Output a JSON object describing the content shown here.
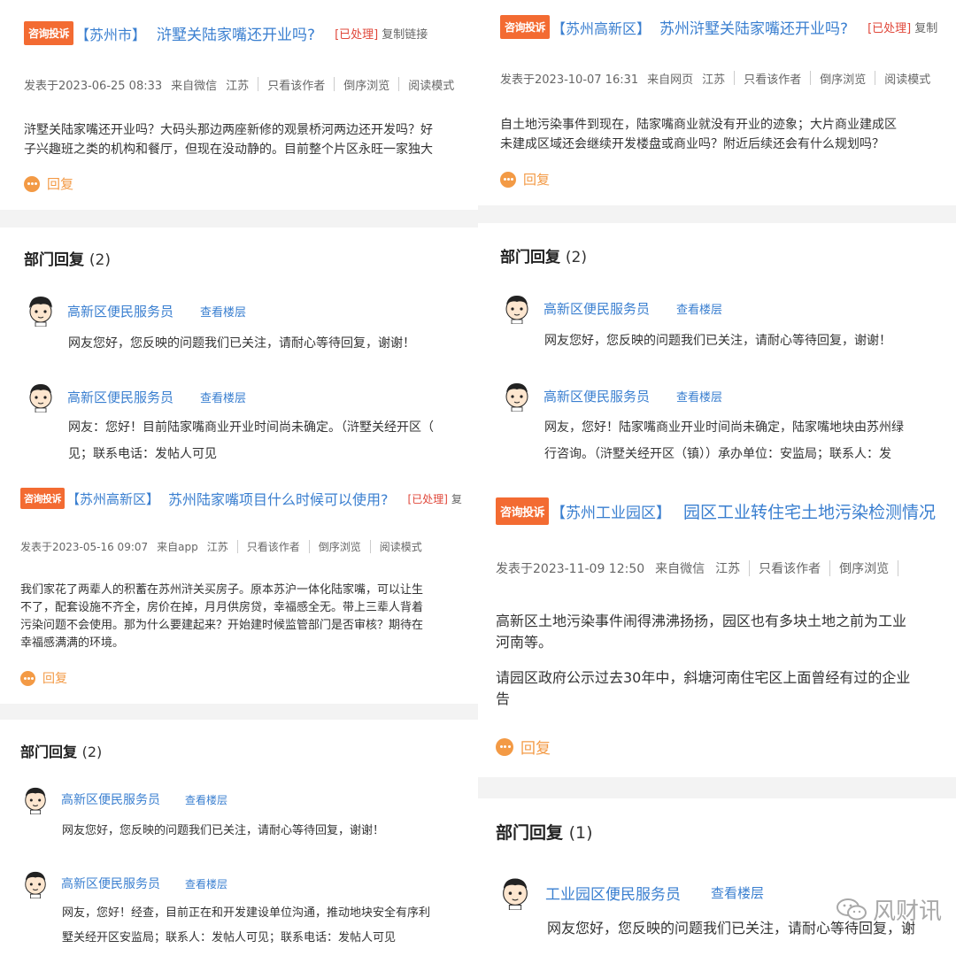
{
  "panels": [
    {
      "badge": "咨询投诉",
      "region": "【苏州市】",
      "title": "浒墅关陆家嘴还开业吗?",
      "status": "[已处理]",
      "copy": "复制链接",
      "meta": [
        "发表于2023-06-25 08:33",
        "来自微信",
        "江苏",
        "只看该作者",
        "倒序浏览",
        "阅读模式"
      ],
      "content": [
        "浒墅关陆家嘴还开业吗？大码头那边两座新修的观景桥河两边还开发吗？好",
        "子兴趣班之类的机构和餐厅，但现在没动静的。目前整个片区永旺一家独大"
      ],
      "reply": "回复",
      "dept_title": "部门回复",
      "dept_count": "(2)",
      "replies": [
        {
          "name": "高新区便民服务员",
          "check": "查看楼层",
          "lines": [
            "网友您好，您反映的问题我们已关注，请耐心等待回复，谢谢！"
          ]
        },
        {
          "name": "高新区便民服务员",
          "check": "查看楼层",
          "lines": [
            "网友：您好！目前陆家嘴商业开业时间尚未确定。（浒墅关经开区（",
            "见；联系电话：发帖人可见"
          ]
        }
      ]
    },
    {
      "badge": "咨询投诉",
      "region": "【苏州高新区】",
      "title": "苏州浒墅关陆家嘴还开业吗?",
      "status": "[已处理]",
      "copy": "复制",
      "meta": [
        "发表于2023-10-07 16:31",
        "来自网页",
        "江苏",
        "只看该作者",
        "倒序浏览",
        "阅读模式"
      ],
      "content": [
        "自土地污染事件到现在，陆家嘴商业就没有开业的迹象；大片商业建成区",
        "未建成区域还会继续开发楼盘或商业吗？附近后续还会有什么规划吗？"
      ],
      "reply": "回复",
      "dept_title": "部门回复",
      "dept_count": "(2)",
      "replies": [
        {
          "name": "高新区便民服务员",
          "check": "查看楼层",
          "lines": [
            "网友您好，您反映的问题我们已关注，请耐心等待回复，谢谢！"
          ]
        },
        {
          "name": "高新区便民服务员",
          "check": "查看楼层",
          "lines": [
            "网友，您好！陆家嘴商业开业时间尚未确定，陆家嘴地块由苏州绿",
            "行咨询。（浒墅关经开区（镇））承办单位：安监局；联系人：发"
          ]
        }
      ]
    },
    {
      "badge": "咨询投诉",
      "region": "【苏州高新区】",
      "title": "苏州陆家嘴项目什么时候可以使用?",
      "status": "[已处理]",
      "copy": "复",
      "meta": [
        "发表于2023-05-16 09:07",
        "来自app",
        "江苏",
        "只看该作者",
        "倒序浏览",
        "阅读模式"
      ],
      "content": [
        "我们家花了两辈人的积蓄在苏州浒关买房子。原本苏沪一体化陆家嘴，可以让生",
        "不了，配套设施不齐全，房价在掉，月月供房贷，幸福感全无。带上三辈人背着",
        "污染问题不会使用。那为什么要建起来？开始建时候监管部门是否审核？期待在",
        "幸福感满满的环境。"
      ],
      "reply": "回复",
      "dept_title": "部门回复",
      "dept_count": "(2)",
      "replies": [
        {
          "name": "高新区便民服务员",
          "check": "查看楼层",
          "lines": [
            "网友您好，您反映的问题我们已关注，请耐心等待回复，谢谢！"
          ]
        },
        {
          "name": "高新区便民服务员",
          "check": "查看楼层",
          "lines": [
            "网友，您好！经查，目前正在和开发建设单位沟通，推动地块安全有序利",
            "墅关经开区安监局；联系人：发帖人可见；联系电话：发帖人可见"
          ]
        }
      ]
    },
    {
      "badge": "咨询投诉",
      "region": "【苏州工业园区】",
      "title": "园区工业转住宅土地污染检测情况",
      "status": "",
      "copy": "",
      "meta": [
        "发表于2023-11-09 12:50",
        "来自微信",
        "江苏",
        "只看该作者",
        "倒序浏览"
      ],
      "content": [
        "高新区土地污染事件闹得沸沸扬扬，园区也有多块土地之前为工业",
        "河南等。",
        "",
        "请园区政府公示过去30年中，斜塘河南住宅区上面曾经有过的企业",
        "告"
      ],
      "reply": "回复",
      "dept_title": "部门回复",
      "dept_count": "(1)",
      "replies": [
        {
          "name": "工业园区便民服务员",
          "check": "查看楼层",
          "lines": [
            "网友您好，您反映的问题我们已关注，请耐心等待回复，谢"
          ]
        }
      ]
    }
  ],
  "watermark": "风财讯",
  "colors": {
    "badge": "#f36b32",
    "link": "#3a7fd0",
    "status": "#e0473a",
    "reply": "#f39a45",
    "divider": "#f3f3f3"
  }
}
